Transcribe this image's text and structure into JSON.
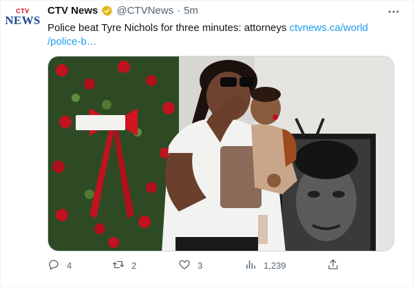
{
  "tweet": {
    "account": {
      "avatar_logo_top": "CTV",
      "avatar_logo_bottom": "NEWS",
      "display_name": "CTV News",
      "verified": true,
      "handle": "@CTVNews",
      "separator": "·",
      "time": "5m"
    },
    "more_icon": "more-horizontal-icon",
    "text": "Police beat Tyre Nichols for three minutes: attorneys ",
    "link_line1": "ctvnews.ca/world",
    "link_line2": "/police-b…",
    "media": {
      "image": "photo of a mourner holding a child beside a floral arrangement and a portrait"
    },
    "actions": {
      "reply": {
        "icon": "reply-icon",
        "count": "4"
      },
      "retweet": {
        "icon": "retweet-icon",
        "count": "2"
      },
      "like": {
        "icon": "heart-icon",
        "count": "3"
      },
      "views": {
        "icon": "views-icon",
        "count": "1,239"
      },
      "share": {
        "icon": "share-icon"
      }
    },
    "colors": {
      "link": "#1d9bf0",
      "secondary_text": "#536471",
      "verified_badge": "#e2b719"
    }
  }
}
